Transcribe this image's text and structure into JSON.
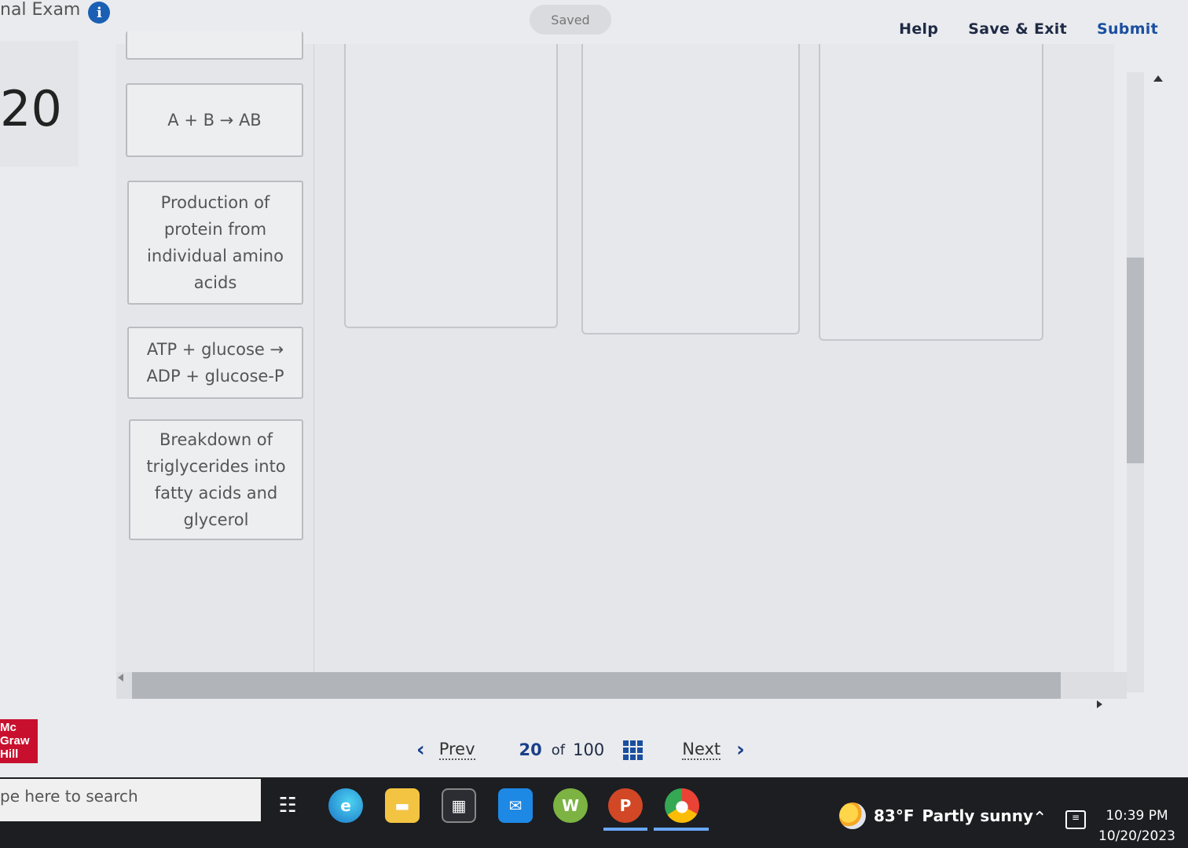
{
  "header": {
    "exam_title": "nal Exam",
    "saved_label": "Saved",
    "help_label": "Help",
    "save_exit_label": "Save & Exit",
    "submit_label": "Submit"
  },
  "question": {
    "number": "20"
  },
  "cards": [
    {
      "text": "A + B → AB"
    },
    {
      "text": "Production of protein from individual amino acids"
    },
    {
      "text": "ATP + glucose → ADP + glucose-P"
    },
    {
      "text": "Breakdown of triglycerides into fatty acids and glycerol"
    }
  ],
  "pager": {
    "prev_label": "Prev",
    "current": "20",
    "of_label": "of",
    "total": "100",
    "next_label": "Next"
  },
  "brand": {
    "line1": "Mc",
    "line2": "Graw",
    "line3": "Hill",
    "color": "#c8102e"
  },
  "taskbar": {
    "search_placeholder": "pe here to search",
    "weather_temp": "83°F",
    "weather_desc": "Partly sunny",
    "time": "10:39 PM",
    "date": "10/20/2023"
  }
}
